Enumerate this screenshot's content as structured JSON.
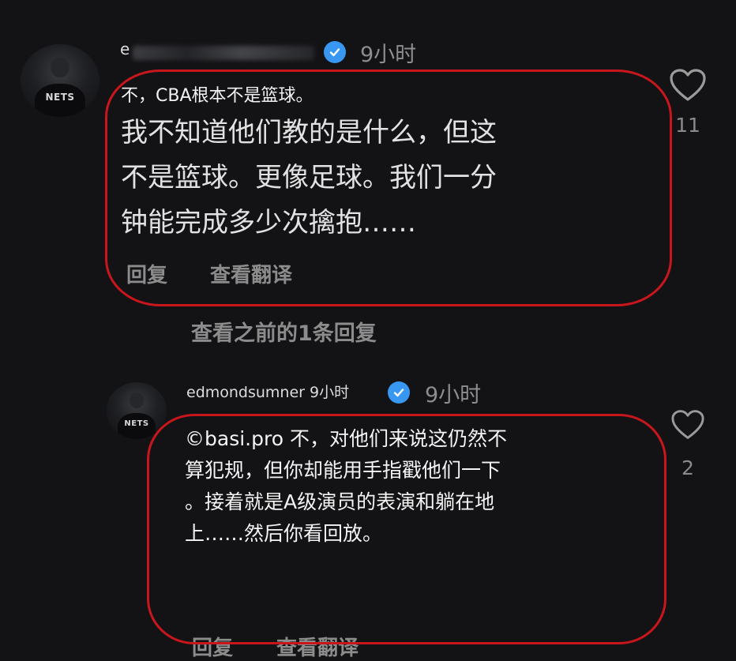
{
  "comments": [
    {
      "username_visible": "e",
      "time": "9小时",
      "title_line": "不，CBA根本不是篮球。",
      "text_lines": [
        "我不知道他们教的是什么，但这",
        "不是篮球。更像足球。我们一分",
        "钟能完成多少次擒抱……"
      ],
      "actions": {
        "reply": "回复",
        "translate": "查看翻译"
      },
      "likes": "11",
      "avatar_text": "NETS"
    },
    {
      "username": "edmondsumner 9小时",
      "time": "9小时",
      "text_lines": [
        "©basi.pro 不，对他们来说这仍然不",
        "算犯规，但你却能用手指戳他们一下",
        "。接着就是A级演员的表演和躺在地",
        "上……然后你看回放。"
      ],
      "actions": {
        "reply": "回复",
        "translate": "查看翻译"
      },
      "likes": "2",
      "avatar_text": "NETS"
    }
  ],
  "view_previous_replies": "查看之前的1条回复",
  "colors": {
    "background": "#131316",
    "highlight": "#c8161d",
    "verified": "#3897f0"
  },
  "icons": [
    "heart-icon",
    "verified-badge-icon",
    "avatar"
  ]
}
